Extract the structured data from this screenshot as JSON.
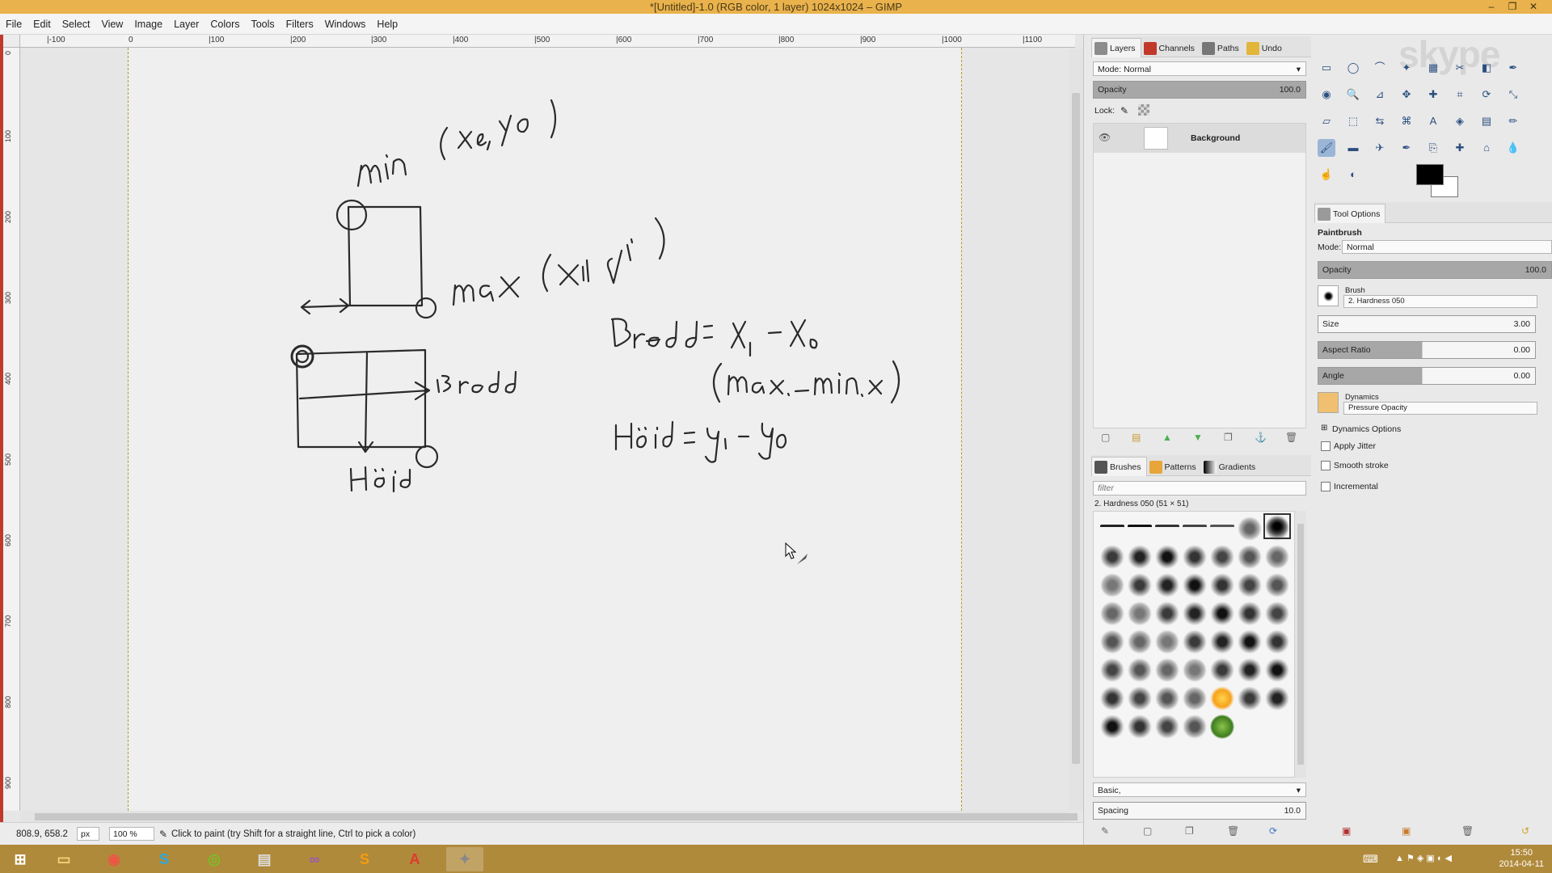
{
  "window": {
    "title": "*[Untitled]-1.0 (RGB color, 1 layer) 1024x1024 – GIMP",
    "minimize": "–",
    "maximize": "❐",
    "close": "✕"
  },
  "menu": [
    "File",
    "Edit",
    "Select",
    "View",
    "Image",
    "Layer",
    "Colors",
    "Tools",
    "Filters",
    "Windows",
    "Help"
  ],
  "ruler": {
    "h_labels": [
      "|-100",
      "0",
      "|100",
      "|200",
      "|300",
      "|400",
      "|500",
      "|600",
      "|700",
      "|800",
      "|900",
      "|1000",
      "|1100"
    ],
    "v_labels": [
      "0",
      "100",
      "200",
      "300",
      "400",
      "500",
      "600",
      "700",
      "800",
      "900"
    ]
  },
  "status": {
    "coords": "808.9, 658.2",
    "unit": "px",
    "zoom": "100 %",
    "message": "Click to paint (try Shift for a straight line, Ctrl to pick a color)"
  },
  "layers_panel": {
    "tabs": [
      "Layers",
      "Channels",
      "Paths",
      "Undo"
    ],
    "mode_label": "Mode: Normal",
    "opacity_label": "Opacity",
    "opacity_value": "100.0",
    "lock_label": "Lock:",
    "layer_name": "Background"
  },
  "brushes_panel": {
    "tabs": [
      "Brushes",
      "Patterns",
      "Gradients"
    ],
    "filter_placeholder": "filter",
    "brush_name": "2. Hardness 050 (51 × 51)",
    "tag": "Basic,",
    "spacing_label": "Spacing",
    "spacing_value": "10.0"
  },
  "tool_options": {
    "tab": "Tool Options",
    "tool_name": "Paintbrush",
    "mode_label": "Mode:",
    "mode_value": "Normal",
    "opacity_label": "Opacity",
    "opacity_value": "100.0",
    "brush_label": "Brush",
    "brush_value": "2. Hardness 050",
    "size_label": "Size",
    "size_value": "3.00",
    "aspect_label": "Aspect Ratio",
    "aspect_value": "0.00",
    "angle_label": "Angle",
    "angle_value": "0.00",
    "dynamics_label": "Dynamics",
    "dynamics_value": "Pressure Opacity",
    "dynamics_options": "Dynamics Options",
    "apply_jitter": "Apply Jitter",
    "smooth_stroke": "Smooth stroke",
    "incremental": "Incremental"
  },
  "watermark": "skype",
  "taskbar": {
    "time": "15:50",
    "date": "2014-04-11"
  },
  "colors": {
    "titlebar": "#e9b24c",
    "taskbar": "#b08a3b",
    "fg_color": "#000000",
    "bg_color": "#ffffff"
  }
}
